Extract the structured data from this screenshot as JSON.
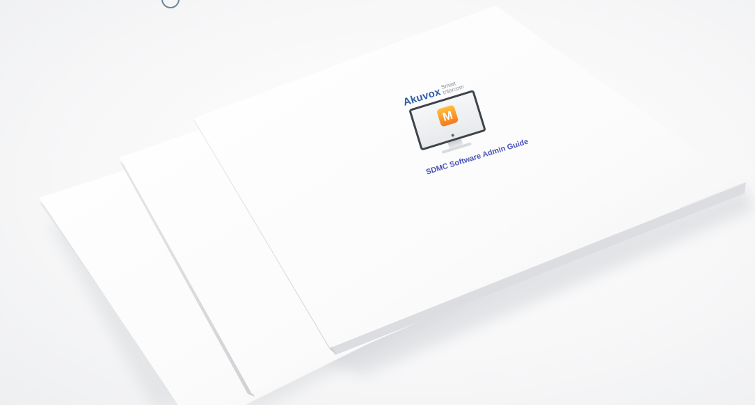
{
  "cover": {
    "brand": "Akuvox",
    "tagline_line1": "Smart",
    "tagline_line2": "Intercom",
    "app_icon_letter": "M",
    "title": "SDMC Software Admin Guide"
  },
  "colors": {
    "brand_blue": "#2f5ea8",
    "title_blue": "#4a54b8",
    "icon_orange": "#f57a1f",
    "icon_yellow": "#ffbf3a",
    "monitor_bezel": "#3e444b",
    "paper_white": "#ffffff"
  },
  "icons": {
    "app": "m-app-icon",
    "device": "monitor-icon"
  }
}
